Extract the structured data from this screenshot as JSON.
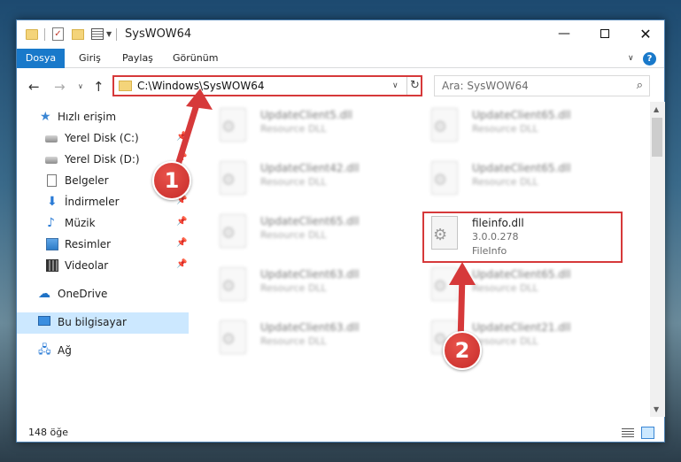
{
  "window": {
    "title": "SysWOW64",
    "minimize": "—",
    "close": "✕"
  },
  "ribbon": {
    "tabs": [
      "Dosya",
      "Giriş",
      "Paylaş",
      "Görünüm"
    ]
  },
  "address": {
    "path": "C:\\Windows\\SysWOW64",
    "search_placeholder": "Ara: SysWOW64"
  },
  "nav_pane": {
    "items": [
      {
        "label": "Hızlı erişim",
        "icon": "star-icon"
      },
      {
        "label": "Yerel Disk (C:)",
        "icon": "disk-icon"
      },
      {
        "label": "Yerel Disk (D:)",
        "icon": "disk-icon"
      },
      {
        "label": "Belgeler",
        "icon": "documents-icon"
      },
      {
        "label": "İndirmeler",
        "icon": "downloads-icon"
      },
      {
        "label": "Müzik",
        "icon": "music-icon"
      },
      {
        "label": "Resimler",
        "icon": "pictures-icon"
      },
      {
        "label": "Videolar",
        "icon": "videos-icon"
      },
      {
        "label": "OneDrive",
        "icon": "onedrive-icon"
      },
      {
        "label": "Bu bilgisayar",
        "icon": "computer-icon"
      },
      {
        "label": "Ağ",
        "icon": "network-icon"
      }
    ]
  },
  "files": [
    {
      "name": "UpdateClient5.dll",
      "type": "Resource DLL"
    },
    {
      "name": "UpdateClient65.dll",
      "type": "Resource DLL"
    },
    {
      "name": "UpdateClient42.dll",
      "type": "Resource DLL"
    },
    {
      "name": "UpdateClient65.dll",
      "type": "Resource DLL"
    },
    {
      "name": "UpdateClient65.dll",
      "type": "Resource DLL"
    },
    {
      "name": "fileinfo.dll",
      "version": "3.0.0.278",
      "type": "FileInfo"
    },
    {
      "name": "UpdateClient63.dll",
      "type": "Resource DLL"
    },
    {
      "name": "UpdateClient65.dll",
      "type": "Resource DLL"
    },
    {
      "name": "UpdateClient63.dll",
      "type": "Resource DLL"
    },
    {
      "name": "UpdateClient21.dll",
      "type": "Resource DLL"
    }
  ],
  "status": {
    "item_count": "148 öğe"
  },
  "annotations": {
    "step1": "1",
    "step2": "2",
    "color": "#d6393a"
  }
}
